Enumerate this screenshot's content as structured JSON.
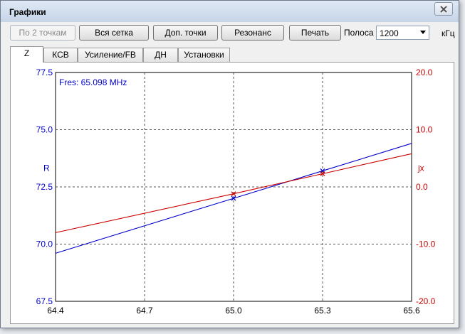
{
  "window": {
    "title": "Графики"
  },
  "toolbar": {
    "btn_two_points": "По 2 точкам",
    "btn_full_grid": "Вся сетка",
    "btn_extra_points": "Доп. точки",
    "btn_resonance": "Резонанс",
    "btn_print": "Печать",
    "band_label": "Полоса",
    "band_value": "1200",
    "band_unit": "кГц"
  },
  "tabs": [
    "Z",
    "КСВ",
    "Усиление/FB",
    "ДН",
    "Установки"
  ],
  "colors": {
    "r_series": "#0000cc",
    "jx_series": "#cc0000",
    "grid": "#555555"
  },
  "chart_data": {
    "type": "line",
    "annotation": "Fres: 65.098 MHz",
    "x_ticks": [
      "64.4",
      "64.7",
      "65.0",
      "65.3",
      "65.6"
    ],
    "xlim": [
      64.4,
      65.6
    ],
    "y_left": {
      "label": "R",
      "ticks": [
        "77.5",
        "75.0",
        "72.5",
        "70.0",
        "67.5"
      ],
      "range": [
        67.5,
        77.5
      ]
    },
    "y_right": {
      "label": "jx",
      "ticks": [
        "20.0",
        "10.0",
        "0.0",
        "-10.0",
        "-20.0"
      ],
      "range": [
        -20,
        20
      ]
    },
    "grid": true,
    "series": [
      {
        "name": "R",
        "axis": "left",
        "x": [
          64.4,
          65.0,
          65.3,
          65.6
        ],
        "y": [
          69.6,
          72.0,
          73.2,
          74.4
        ],
        "markers": [
          65.0,
          65.3
        ]
      },
      {
        "name": "jx",
        "axis": "right",
        "x": [
          64.4,
          65.0,
          65.3,
          65.6
        ],
        "y": [
          -8.0,
          -1.2,
          2.3,
          5.8
        ],
        "markers": [
          65.0,
          65.3
        ]
      }
    ]
  }
}
